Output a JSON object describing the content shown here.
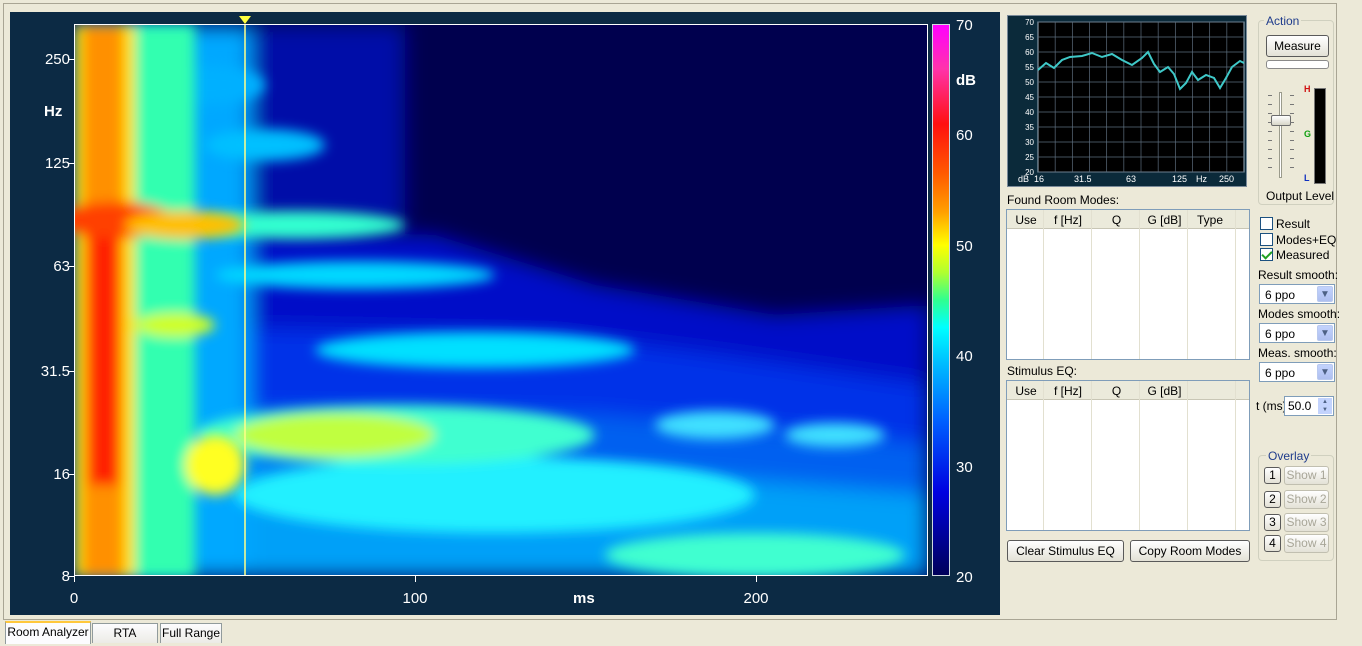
{
  "spectrogram": {
    "y_axis_label": "Hz",
    "x_axis_label": "ms",
    "colorbar_label": "dB",
    "y_ticks": [
      "250",
      "125",
      "63",
      "31.5",
      "16",
      "8"
    ],
    "x_ticks": [
      "0",
      "100",
      "200"
    ],
    "colorbar_ticks": [
      "70",
      "60",
      "50",
      "40",
      "30",
      "20"
    ],
    "cursor_time_ms": 50
  },
  "mini_graph": {
    "y_ticks": [
      "70",
      "65",
      "60",
      "55",
      "50",
      "45",
      "40",
      "35",
      "30",
      "25",
      "20"
    ],
    "x_ticks": [
      "dB",
      "16",
      "31.5",
      "63",
      "125",
      "Hz",
      "250"
    ]
  },
  "found_room_modes": {
    "label": "Found Room Modes:",
    "columns": [
      "Use",
      "f [Hz]",
      "Q",
      "G [dB]",
      "Type"
    ]
  },
  "stimulus_eq": {
    "label": "Stimulus EQ:",
    "columns": [
      "Use",
      "f [Hz]",
      "Q",
      "G [dB]"
    ]
  },
  "buttons": {
    "clear_stimulus_eq": "Clear Stimulus EQ",
    "copy_room_modes": "Copy Room Modes",
    "measure": "Measure"
  },
  "action": {
    "label": "Action",
    "output_level_label": "Output Level",
    "meter_labels": [
      "H",
      "G",
      "L"
    ]
  },
  "checkboxes": [
    {
      "label": "Result",
      "checked": false
    },
    {
      "label": "Modes+EQ",
      "checked": false
    },
    {
      "label": "Measured",
      "checked": true
    }
  ],
  "smoothing": {
    "result_label": "Result smooth:",
    "result_value": "6 ppo",
    "modes_label": "Modes smooth:",
    "modes_value": "6 ppo",
    "meas_label": "Meas. smooth:",
    "meas_value": "6 ppo"
  },
  "time": {
    "label": "t (ms)",
    "value": "50.0"
  },
  "overlay": {
    "label": "Overlay",
    "items": [
      {
        "num": "1",
        "label": "Show 1"
      },
      {
        "num": "2",
        "label": "Show 2"
      },
      {
        "num": "3",
        "label": "Show 3"
      },
      {
        "num": "4",
        "label": "Show 4"
      }
    ]
  },
  "tabs": [
    "Room Analyzer",
    "RTA",
    "Full Range"
  ],
  "colors": {
    "plot_background": "#0c2a44",
    "mini_curve": "#3fc8c8",
    "cursor": "#ffff66"
  }
}
